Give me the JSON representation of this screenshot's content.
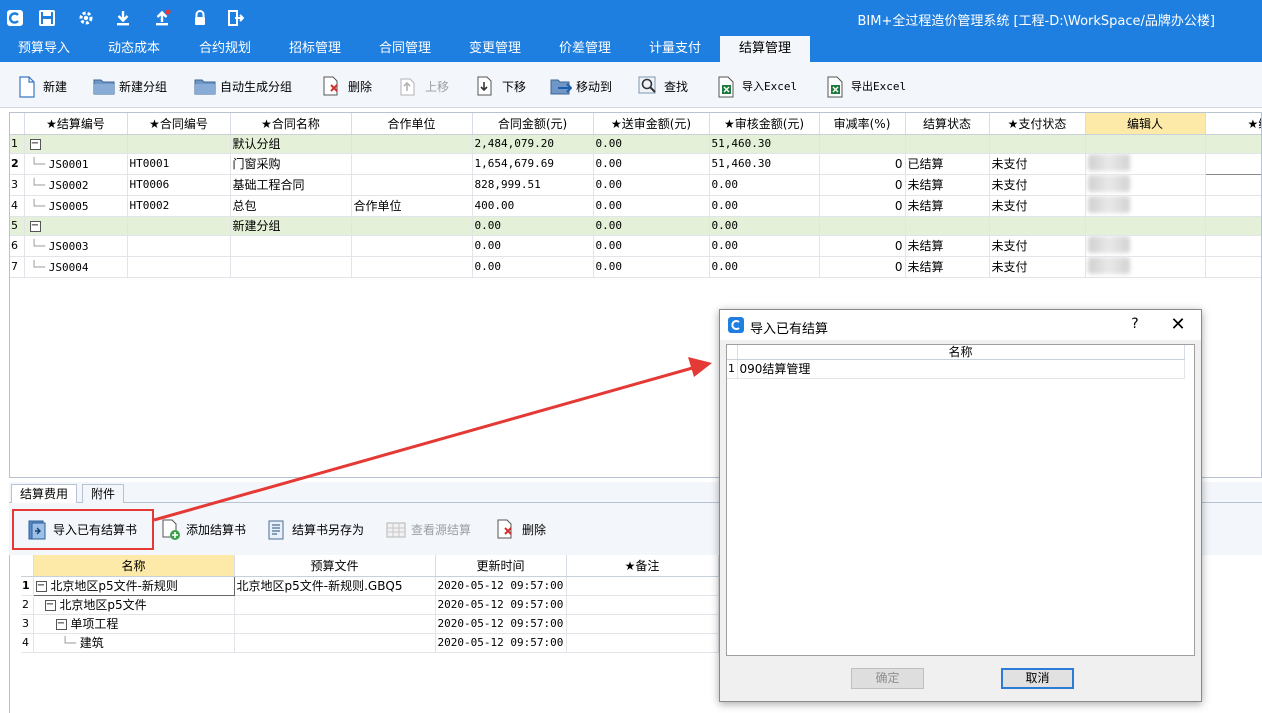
{
  "window": {
    "title": "BIM+全过程造价管理系统 [工程-D:\\WorkSpace/品牌办公楼]"
  },
  "menu": {
    "items": [
      "预算导入",
      "动态成本",
      "合约规划",
      "招标管理",
      "合同管理",
      "变更管理",
      "价差管理",
      "计量支付",
      "结算管理"
    ],
    "active": "结算管理"
  },
  "toolbar": {
    "new": "新建",
    "new_group": "新建分组",
    "auto_group": "自动生成分组",
    "delete": "删除",
    "move_up": "上移",
    "move_down": "下移",
    "move_to": "移动到",
    "find": "查找",
    "import_excel": "导入Excel",
    "export_excel": "导出Excel"
  },
  "main_table": {
    "headers": [
      "★结算编号",
      "★合同编号",
      "★合同名称",
      "合作单位",
      "合同金额(元)",
      "★送审金额(元)",
      "★审核金额(元)",
      "审减率(%)",
      "结算状态",
      "★支付状态",
      "编辑人",
      "★编"
    ],
    "rows": [
      {
        "n": "1",
        "group": true,
        "code": "",
        "contract": "",
        "name": "默认分组",
        "partner": "",
        "amount": "2,484,079.20",
        "submit": "0.00",
        "audit": "51,460.30",
        "rate": "",
        "status": "",
        "pay": ""
      },
      {
        "n": "2",
        "group": false,
        "code": "JS0001",
        "contract": "HT0001",
        "name": "门窗采购",
        "partner": "",
        "amount": "1,654,679.69",
        "submit": "0.00",
        "audit": "51,460.30",
        "rate": "0",
        "status": "已结算",
        "pay": "未支付"
      },
      {
        "n": "3",
        "group": false,
        "code": "JS0002",
        "contract": "HT0006",
        "name": "基础工程合同",
        "partner": "",
        "amount": "828,999.51",
        "submit": "0.00",
        "audit": "0.00",
        "rate": "0",
        "status": "未结算",
        "pay": "未支付"
      },
      {
        "n": "4",
        "group": false,
        "code": "JS0005",
        "contract": "HT0002",
        "name": "总包",
        "partner": "合作单位",
        "amount": "400.00",
        "submit": "0.00",
        "audit": "0.00",
        "rate": "0",
        "status": "未结算",
        "pay": "未支付"
      },
      {
        "n": "5",
        "group": true,
        "code": "",
        "contract": "",
        "name": "新建分组",
        "partner": "",
        "amount": "0.00",
        "submit": "0.00",
        "audit": "0.00",
        "rate": "",
        "status": "",
        "pay": ""
      },
      {
        "n": "6",
        "group": false,
        "code": "JS0003",
        "contract": "",
        "name": "",
        "partner": "",
        "amount": "0.00",
        "submit": "0.00",
        "audit": "0.00",
        "rate": "0",
        "status": "未结算",
        "pay": "未支付"
      },
      {
        "n": "7",
        "group": false,
        "code": "JS0004",
        "contract": "",
        "name": "",
        "partner": "",
        "amount": "0.00",
        "submit": "0.00",
        "audit": "0.00",
        "rate": "0",
        "status": "未结算",
        "pay": "未支付"
      }
    ]
  },
  "bottom_tabs": {
    "fees": "结算费用",
    "attachments": "附件"
  },
  "bottom_toolbar": {
    "import_existing": "导入已有结算书",
    "add_book": "添加结算书",
    "save_as": "结算书另存为",
    "view_source": "查看源结算",
    "delete": "删除"
  },
  "bottom_table": {
    "headers": [
      "名称",
      "预算文件",
      "更新时间",
      "★备注"
    ],
    "rows": [
      {
        "n": "1",
        "name": "北京地区p5文件-新规则",
        "file": "北京地区p5文件-新规则.GBQ5",
        "time": "2020-05-12 09:57:00",
        "note": ""
      },
      {
        "n": "2",
        "name": "北京地区p5文件",
        "file": "",
        "time": "2020-05-12 09:57:00",
        "note": ""
      },
      {
        "n": "3",
        "name": "单项工程",
        "file": "",
        "time": "2020-05-12 09:57:00",
        "note": ""
      },
      {
        "n": "4",
        "name": "建筑",
        "file": "",
        "time": "2020-05-12 09:57:00",
        "note": ""
      }
    ]
  },
  "dialog": {
    "title": "导入已有结算",
    "help": "?",
    "column": "名称",
    "rows": [
      {
        "n": "1",
        "name": "090结算管理"
      }
    ],
    "ok": "确定",
    "cancel": "取消"
  },
  "colors": {
    "titlebar": "#1e7fe0",
    "group_row": "#e4f1d8",
    "selected_header": "#fde9a8",
    "highlight": "#e53935"
  }
}
